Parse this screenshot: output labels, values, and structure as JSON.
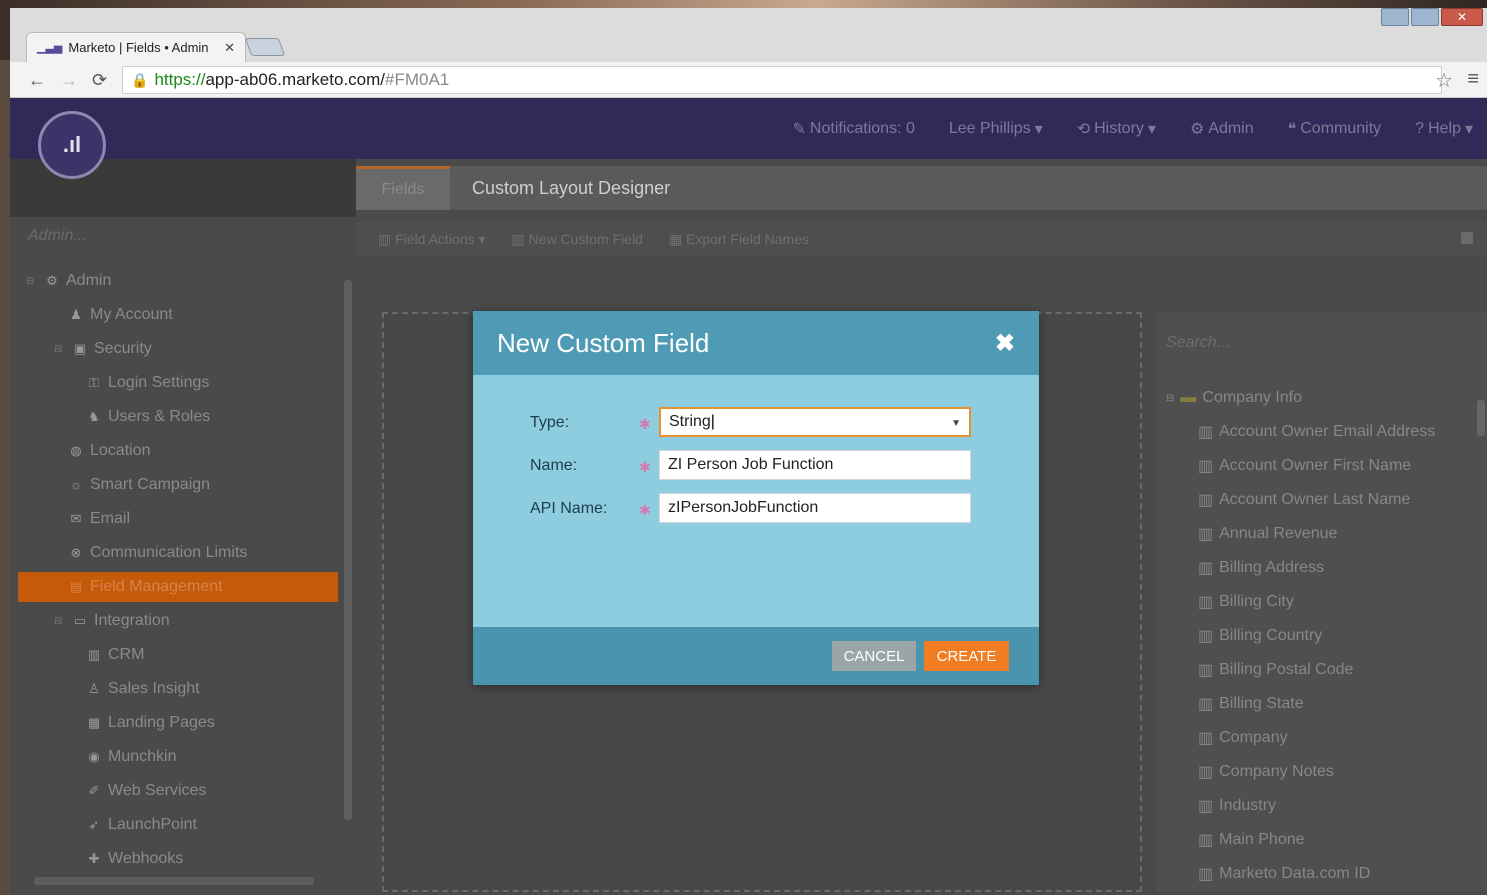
{
  "browser": {
    "tab_title": "Marketo | Fields • Admin",
    "url_https": "https://",
    "url_host": "app-ab06.marketo.com/",
    "url_hash": "#FM0A1"
  },
  "topnav": {
    "notifications": "Notifications: 0",
    "user": "Lee Phillips",
    "history": "History",
    "admin": "Admin",
    "community": "Community",
    "help": "Help"
  },
  "sidebar": {
    "search_placeholder": "Admin...",
    "items": [
      {
        "label": "Admin",
        "icon": "gear-icon"
      },
      {
        "label": "My Account",
        "icon": "person-icon"
      },
      {
        "label": "Security",
        "icon": "lock-icon"
      },
      {
        "label": "Login Settings",
        "icon": "key-icon"
      },
      {
        "label": "Users & Roles",
        "icon": "users-icon"
      },
      {
        "label": "Location",
        "icon": "globe-icon"
      },
      {
        "label": "Smart Campaign",
        "icon": "bulb-icon"
      },
      {
        "label": "Email",
        "icon": "email-icon"
      },
      {
        "label": "Communication Limits",
        "icon": "limit-icon"
      },
      {
        "label": "Field Management",
        "icon": "fields-icon"
      },
      {
        "label": "Integration",
        "icon": "integration-icon"
      },
      {
        "label": "CRM",
        "icon": "crm-icon"
      },
      {
        "label": "Sales Insight",
        "icon": "sales-icon"
      },
      {
        "label": "Landing Pages",
        "icon": "page-icon"
      },
      {
        "label": "Munchkin",
        "icon": "munchkin-icon"
      },
      {
        "label": "Web Services",
        "icon": "services-icon"
      },
      {
        "label": "LaunchPoint",
        "icon": "rocket-icon"
      },
      {
        "label": "Webhooks",
        "icon": "webhook-icon"
      }
    ]
  },
  "main": {
    "tab_fields": "Fields",
    "tab_layout": "Custom Layout Designer",
    "toolbar": {
      "field_actions": "Field Actions",
      "new_custom_field": "New Custom Field",
      "export_field_names": "Export Field Names"
    }
  },
  "right_panel": {
    "search_placeholder": "Search...",
    "group": "Company Info",
    "fields": [
      "Account Owner Email Address",
      "Account Owner First Name",
      "Account Owner Last Name",
      "Annual Revenue",
      "Billing Address",
      "Billing City",
      "Billing Country",
      "Billing Postal Code",
      "Billing State",
      "Company",
      "Company Notes",
      "Industry",
      "Main Phone",
      "Marketo Data.com ID"
    ]
  },
  "modal": {
    "title": "New Custom Field",
    "type_label": "Type:",
    "type_value": "String",
    "name_label": "Name:",
    "name_value": "ZI Person Job Function",
    "api_label": "API Name:",
    "api_value": "zIPersonJobFunction",
    "cancel": "CANCEL",
    "create": "CREATE"
  },
  "colors": {
    "accent_orange": "#f07d22",
    "modal_header": "#4f9ab4",
    "nav_purple": "#2f2a58"
  }
}
